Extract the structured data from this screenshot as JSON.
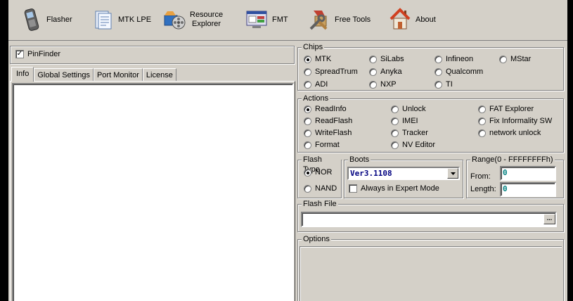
{
  "toolbar": {
    "buttons": [
      {
        "label": "Flasher",
        "icon": "phone-icon"
      },
      {
        "label": "MTK LPE",
        "icon": "document-icon"
      },
      {
        "label": "Resource\nExplorer",
        "icon": "film-reel-icon"
      },
      {
        "label": "FMT",
        "icon": "monitor-icon"
      },
      {
        "label": "Free Tools",
        "icon": "tools-icon"
      },
      {
        "label": "About",
        "icon": "home-icon"
      }
    ]
  },
  "left": {
    "pinfinder_label": "PinFinder",
    "pinfinder_checked": true,
    "tabs": [
      "Info",
      "Global Settings",
      "Port Monitor",
      "License"
    ],
    "active_tab": "Info"
  },
  "chips": {
    "title": "Chips",
    "options": [
      "MTK",
      "SiLabs",
      "Infineon",
      "MStar",
      "SpreadTrum",
      "Anyka",
      "Qualcomm",
      "ADI",
      "NXP",
      "TI"
    ],
    "selected": "MTK"
  },
  "actions": {
    "title": "Actions",
    "options": [
      "ReadInfo",
      "Unlock",
      "FAT Explorer",
      "ReadFlash",
      "IMEI",
      "Fix Informality SW",
      "WriteFlash",
      "Tracker",
      "network unlock",
      "Format",
      "NV Editor"
    ],
    "selected": "ReadInfo"
  },
  "flash_type": {
    "title": "Flash Type",
    "options": [
      "NOR",
      "NAND"
    ],
    "selected": "NOR"
  },
  "boots": {
    "title": "Boots",
    "selected_value": "Ver3.1108",
    "expert_label": "Always in Expert Mode",
    "expert_checked": false
  },
  "range": {
    "title": "Range(0 - FFFFFFFFh)",
    "from_label": "From:",
    "from_value": "0",
    "length_label": "Length:",
    "length_value": "0"
  },
  "flash_file": {
    "title": "Flash File",
    "browse_label": "...",
    "value": ""
  },
  "options": {
    "title": "Options"
  },
  "colors": {
    "window_bg": "#d4d0c8",
    "combo_text": "#000080",
    "value_text": "#008080"
  }
}
